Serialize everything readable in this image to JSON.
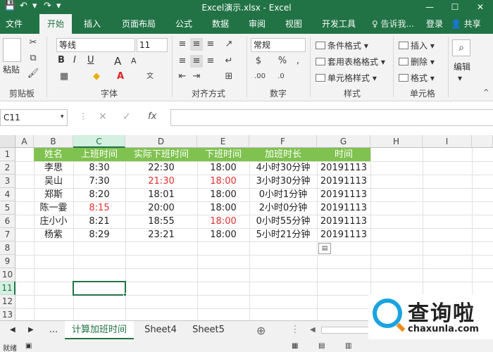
{
  "window": {
    "title": "Excel演示.xlsx - Excel",
    "controls": [
      "—",
      "☐",
      "✕"
    ]
  },
  "ribbon_tabs": [
    "文件",
    "开始",
    "插入",
    "页面布局",
    "公式",
    "数据",
    "审阅",
    "视图",
    "开发工具"
  ],
  "tell_me": "♀ 告诉我...",
  "login": "登录",
  "share": "共享",
  "ribbon": {
    "paste_label": "粘贴",
    "font_name": "等线",
    "font_size": "11",
    "number_format": "常规",
    "conditional_format": "条件格式 ▾",
    "table_format": "套用表格格式 ▾",
    "cell_style": "单元格样式 ▾",
    "insert": "插入 ▾",
    "delete": "删除 ▾",
    "format": "格式 ▾",
    "edit": "编辑",
    "groups": {
      "clipboard": "剪贴板",
      "font": "字体",
      "align": "对齐方式",
      "number": "数字",
      "styles": "样式",
      "cells": "单元格"
    }
  },
  "formula_bar": {
    "name_box": "C11",
    "value": ""
  },
  "columns": [
    "A",
    "B",
    "C",
    "D",
    "E",
    "F",
    "G",
    "H",
    "I"
  ],
  "rows": [
    "1",
    "2",
    "3",
    "4",
    "5",
    "6",
    "7",
    "8",
    "9",
    "10",
    "11",
    "12",
    "13"
  ],
  "table": {
    "headers": [
      "姓名",
      "上班时间",
      "实际下班时间",
      "下班时间",
      "加班时长",
      "时间"
    ],
    "rows": [
      [
        "李思",
        "8:30",
        "22:30",
        "18:00",
        "4小时30分钟",
        "20191113"
      ],
      [
        "吴山",
        "7:30",
        "21:30",
        "18:00",
        "3小时30分钟",
        "20191113"
      ],
      [
        "郑斯",
        "8:20",
        "18:01",
        "18:00",
        "0小时1分钟",
        "20191113"
      ],
      [
        "陈一霎",
        "8:15",
        "20:00",
        "18:00",
        "2小时0分钟",
        "20191113"
      ],
      [
        "庄小小",
        "8:21",
        "18:55",
        "18:00",
        "0小时55分钟",
        "20191113"
      ],
      [
        "杨紫",
        "8:29",
        "23:21",
        "18:00",
        "5小时21分钟",
        "20191113"
      ]
    ]
  },
  "sheets": [
    "...",
    "计算加班时间",
    "Sheet4",
    "Sheet5"
  ],
  "status": "就绪",
  "watermark": {
    "text": "查询啦",
    "url": "chaxunla.com"
  },
  "colors": {
    "excel_green": "#217346",
    "header_fill": "#7fc24f",
    "red_text": "#e03030"
  }
}
